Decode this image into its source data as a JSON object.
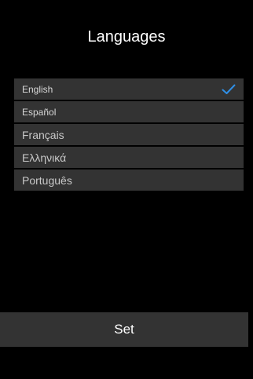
{
  "screen": {
    "title": "Languages"
  },
  "languages": [
    {
      "label": "English",
      "selected": true
    },
    {
      "label": "Español",
      "selected": false
    },
    {
      "label": "Français",
      "selected": false
    },
    {
      "label": "Ελληνικά",
      "selected": false
    },
    {
      "label": "Português",
      "selected": false
    }
  ],
  "actions": {
    "set_label": "Set"
  },
  "colors": {
    "background": "#000000",
    "row_background": "#333333",
    "check_accent": "#2f8fe6",
    "text": "#ffffff"
  },
  "icons": {
    "selected_indicator": "checkmark-icon"
  }
}
